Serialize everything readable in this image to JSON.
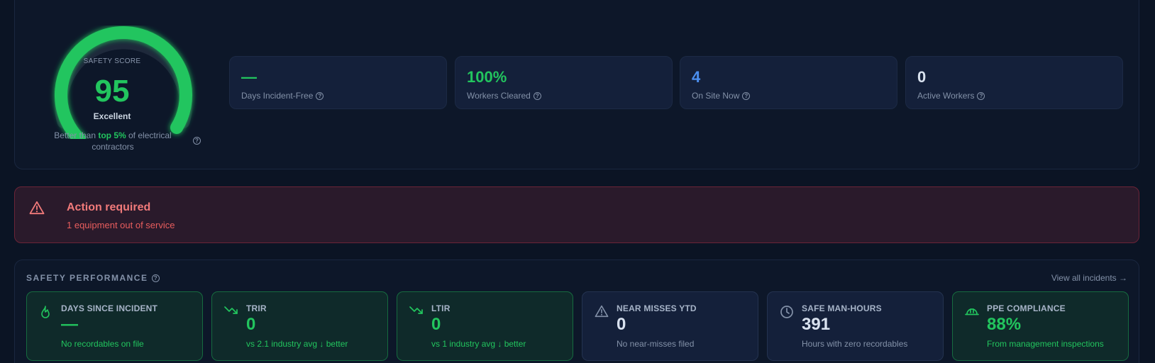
{
  "colors": {
    "accent_green": "#22c55e",
    "accent_blue": "#4b8ff0",
    "alert_red": "#f17a7a",
    "background": "#0b1424"
  },
  "safety_score": {
    "title": "SAFETY SCORE",
    "score": "95",
    "score_fraction": 0.95,
    "rating": "Excellent",
    "note_prefix": "Better than ",
    "note_highlight": "top 5%",
    "note_suffix": " of electrical contractors"
  },
  "stats": [
    {
      "value": "—",
      "label": "Days Incident-Free",
      "color": "#22c55e"
    },
    {
      "value": "100%",
      "label": "Workers Cleared",
      "color": "#22c55e"
    },
    {
      "value": "4",
      "label": "On Site Now",
      "color": "#4b8ff0"
    },
    {
      "value": "0",
      "label": "Active Workers",
      "color": "#d9e2ef"
    }
  ],
  "alert": {
    "icon": "warning-triangle-icon",
    "title": "Action required",
    "message": "1 equipment out of service"
  },
  "performance": {
    "title": "SAFETY PERFORMANCE",
    "view_all": "View all incidents →",
    "metrics": [
      {
        "icon": "flame-icon",
        "label": "DAYS SINCE INCIDENT",
        "value": "—",
        "sub": "No recordables on file",
        "tone": "green"
      },
      {
        "icon": "trend-down-icon",
        "label": "TRIR",
        "value": "0",
        "sub": "vs 2.1 industry avg ↓ better",
        "tone": "green"
      },
      {
        "icon": "trend-down-icon",
        "label": "LTIR",
        "value": "0",
        "sub": "vs 1 industry avg ↓ better",
        "tone": "green"
      },
      {
        "icon": "warning-triangle-icon",
        "label": "NEAR MISSES YTD",
        "value": "0",
        "sub": "No near-misses filed",
        "tone": "gray"
      },
      {
        "icon": "clock-icon",
        "label": "SAFE MAN-HOURS",
        "value": "391",
        "sub": "Hours with zero recordables",
        "tone": "gray"
      },
      {
        "icon": "hard-hat-icon",
        "label": "PPE COMPLIANCE",
        "value": "88%",
        "sub": "From management inspections",
        "tone": "green"
      }
    ]
  }
}
